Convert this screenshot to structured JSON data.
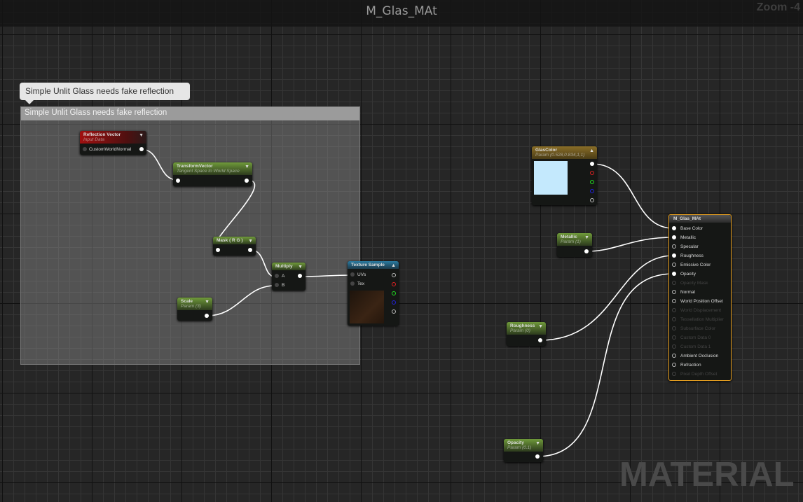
{
  "window": {
    "title": "M_Glas_MAt",
    "zoom": "Zoom -4",
    "watermark": "MATERIAL"
  },
  "comment": {
    "bubble": "Simple Unlit Glass needs fake reflection",
    "title": "Simple Unlit Glass needs fake reflection"
  },
  "nodes": {
    "reflection": {
      "title": "Reflection Vector",
      "sub": "Input Data",
      "pin": "CustomWorldNormal"
    },
    "transform": {
      "title": "TransformVector",
      "sub": "Tangent Space to World Space"
    },
    "mask": {
      "title": "Mask ( R G )"
    },
    "multiply": {
      "title": "Multiply",
      "a": "A",
      "b": "B"
    },
    "scale": {
      "title": "Scale",
      "sub": "Param (3)"
    },
    "texture": {
      "title": "Texture Sample",
      "uvs": "UVs",
      "tex": "Tex"
    },
    "glascolor": {
      "title": "GlasColor",
      "sub": "Param (0.528,0.834,1,1)",
      "color": "#c4e9fd"
    },
    "metallic": {
      "title": "Metallic",
      "sub": "Param (1)"
    },
    "roughness": {
      "title": "Roughness",
      "sub": "Param (0)"
    },
    "opacity": {
      "title": "Opacity",
      "sub": "Param (0.1)"
    },
    "result": {
      "title": "M_Glas_MAt",
      "inputs": [
        {
          "label": "Base Color",
          "enabled": true,
          "connected": true
        },
        {
          "label": "Metallic",
          "enabled": true,
          "connected": true
        },
        {
          "label": "Specular",
          "enabled": true,
          "connected": false
        },
        {
          "label": "Roughness",
          "enabled": true,
          "connected": true
        },
        {
          "label": "Emissive Color",
          "enabled": true,
          "connected": false
        },
        {
          "label": "Opacity",
          "enabled": true,
          "connected": true
        },
        {
          "label": "Opacity Mask",
          "enabled": false
        },
        {
          "label": "Normal",
          "enabled": true
        },
        {
          "label": "World Position Offset",
          "enabled": true
        },
        {
          "label": "World Displacement",
          "enabled": false
        },
        {
          "label": "Tessellation Multiplier",
          "enabled": false
        },
        {
          "label": "Subsurface Color",
          "enabled": false
        },
        {
          "label": "Custom Data 0",
          "enabled": false
        },
        {
          "label": "Custom Data 1",
          "enabled": false
        },
        {
          "label": "Ambient Occlusion",
          "enabled": true
        },
        {
          "label": "Refraction",
          "enabled": true
        },
        {
          "label": "Pixel Depth Offset",
          "enabled": false
        }
      ]
    }
  }
}
